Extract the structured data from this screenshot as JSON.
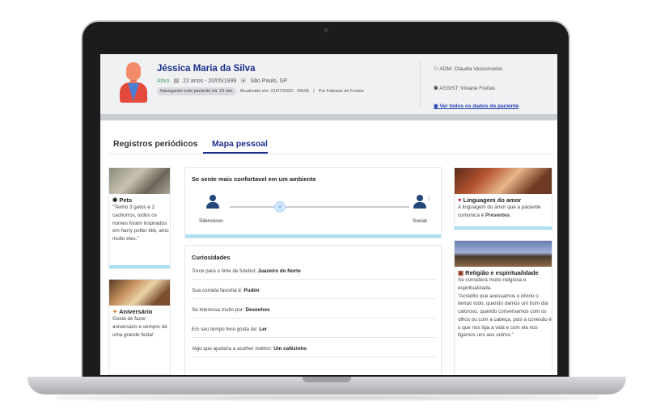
{
  "patient": {
    "name": "Jéssica Maria da Silva",
    "status": "Ativo",
    "birth": "22 anos - 20/05/1999",
    "location": "São Paulo, SP",
    "browsing": "Navegando este paciente há: 10 min",
    "updated": "Atualizado em: 21/07/2020 - 09h05",
    "updated_by": "Por Fabiana de Freitas"
  },
  "staff": {
    "adm": "ADM: Cláudia Vasconselos",
    "assist": "ASSIST: Viviane Freitas",
    "all_data_link": "Ver todos os dados do paciente"
  },
  "tabs": [
    {
      "label": "Registros periódicos",
      "active": false
    },
    {
      "label": "Mapa pessoal",
      "active": true
    }
  ],
  "cards": {
    "pets": {
      "title": "Pets",
      "text": "“Tenho 3 gatos e 2 cachorros, todos os nomes foram inspirados em harry potter kkk, amo muito eles.”"
    },
    "birthday": {
      "title": "Aniversário",
      "text": "Gosta de fazer aniversário e sempre dá uma grande festa!"
    },
    "environment": {
      "title": "Se sente mais confortavel em um ambiente",
      "left_label": "Silencioso",
      "right_label": "Social",
      "level": 0.28
    },
    "curiosities": {
      "title": "Curiosidades",
      "rows": [
        {
          "label": "Torce para o time de futebol:",
          "value": "Juazeiro do Norte"
        },
        {
          "label": "Sua comida favorita é:",
          "value": "Pudim"
        },
        {
          "label": "Se interessa muito por:",
          "value": "Desenhos"
        },
        {
          "label": "Em seu tempo livre gosta de:",
          "value": "Ler"
        },
        {
          "label": "Algo que ajudaria a acolher melhor:",
          "value": "Um cafézinho"
        }
      ]
    },
    "love": {
      "title": "Linguagem do amor",
      "text": "A linguagem do amor que a paciente comunica é",
      "value": "Presentes"
    },
    "religion": {
      "title": "Religião e espiritualidade",
      "text1": "Se considera muito religiosa e espiritualizada.",
      "text2": "“Acredito que acessamos o divino o tempo todo, quando damos um bom dia caloroso, quando conversamos com os olhos ou com a cabeça, pois a conexão é o que nos liga a vida e com ela nos ligamos uns aos outros.”"
    }
  },
  "colors": {
    "brand": "#1c2e8c",
    "accent_bar": "#aee0f5",
    "active_green": "#3aa35a"
  }
}
